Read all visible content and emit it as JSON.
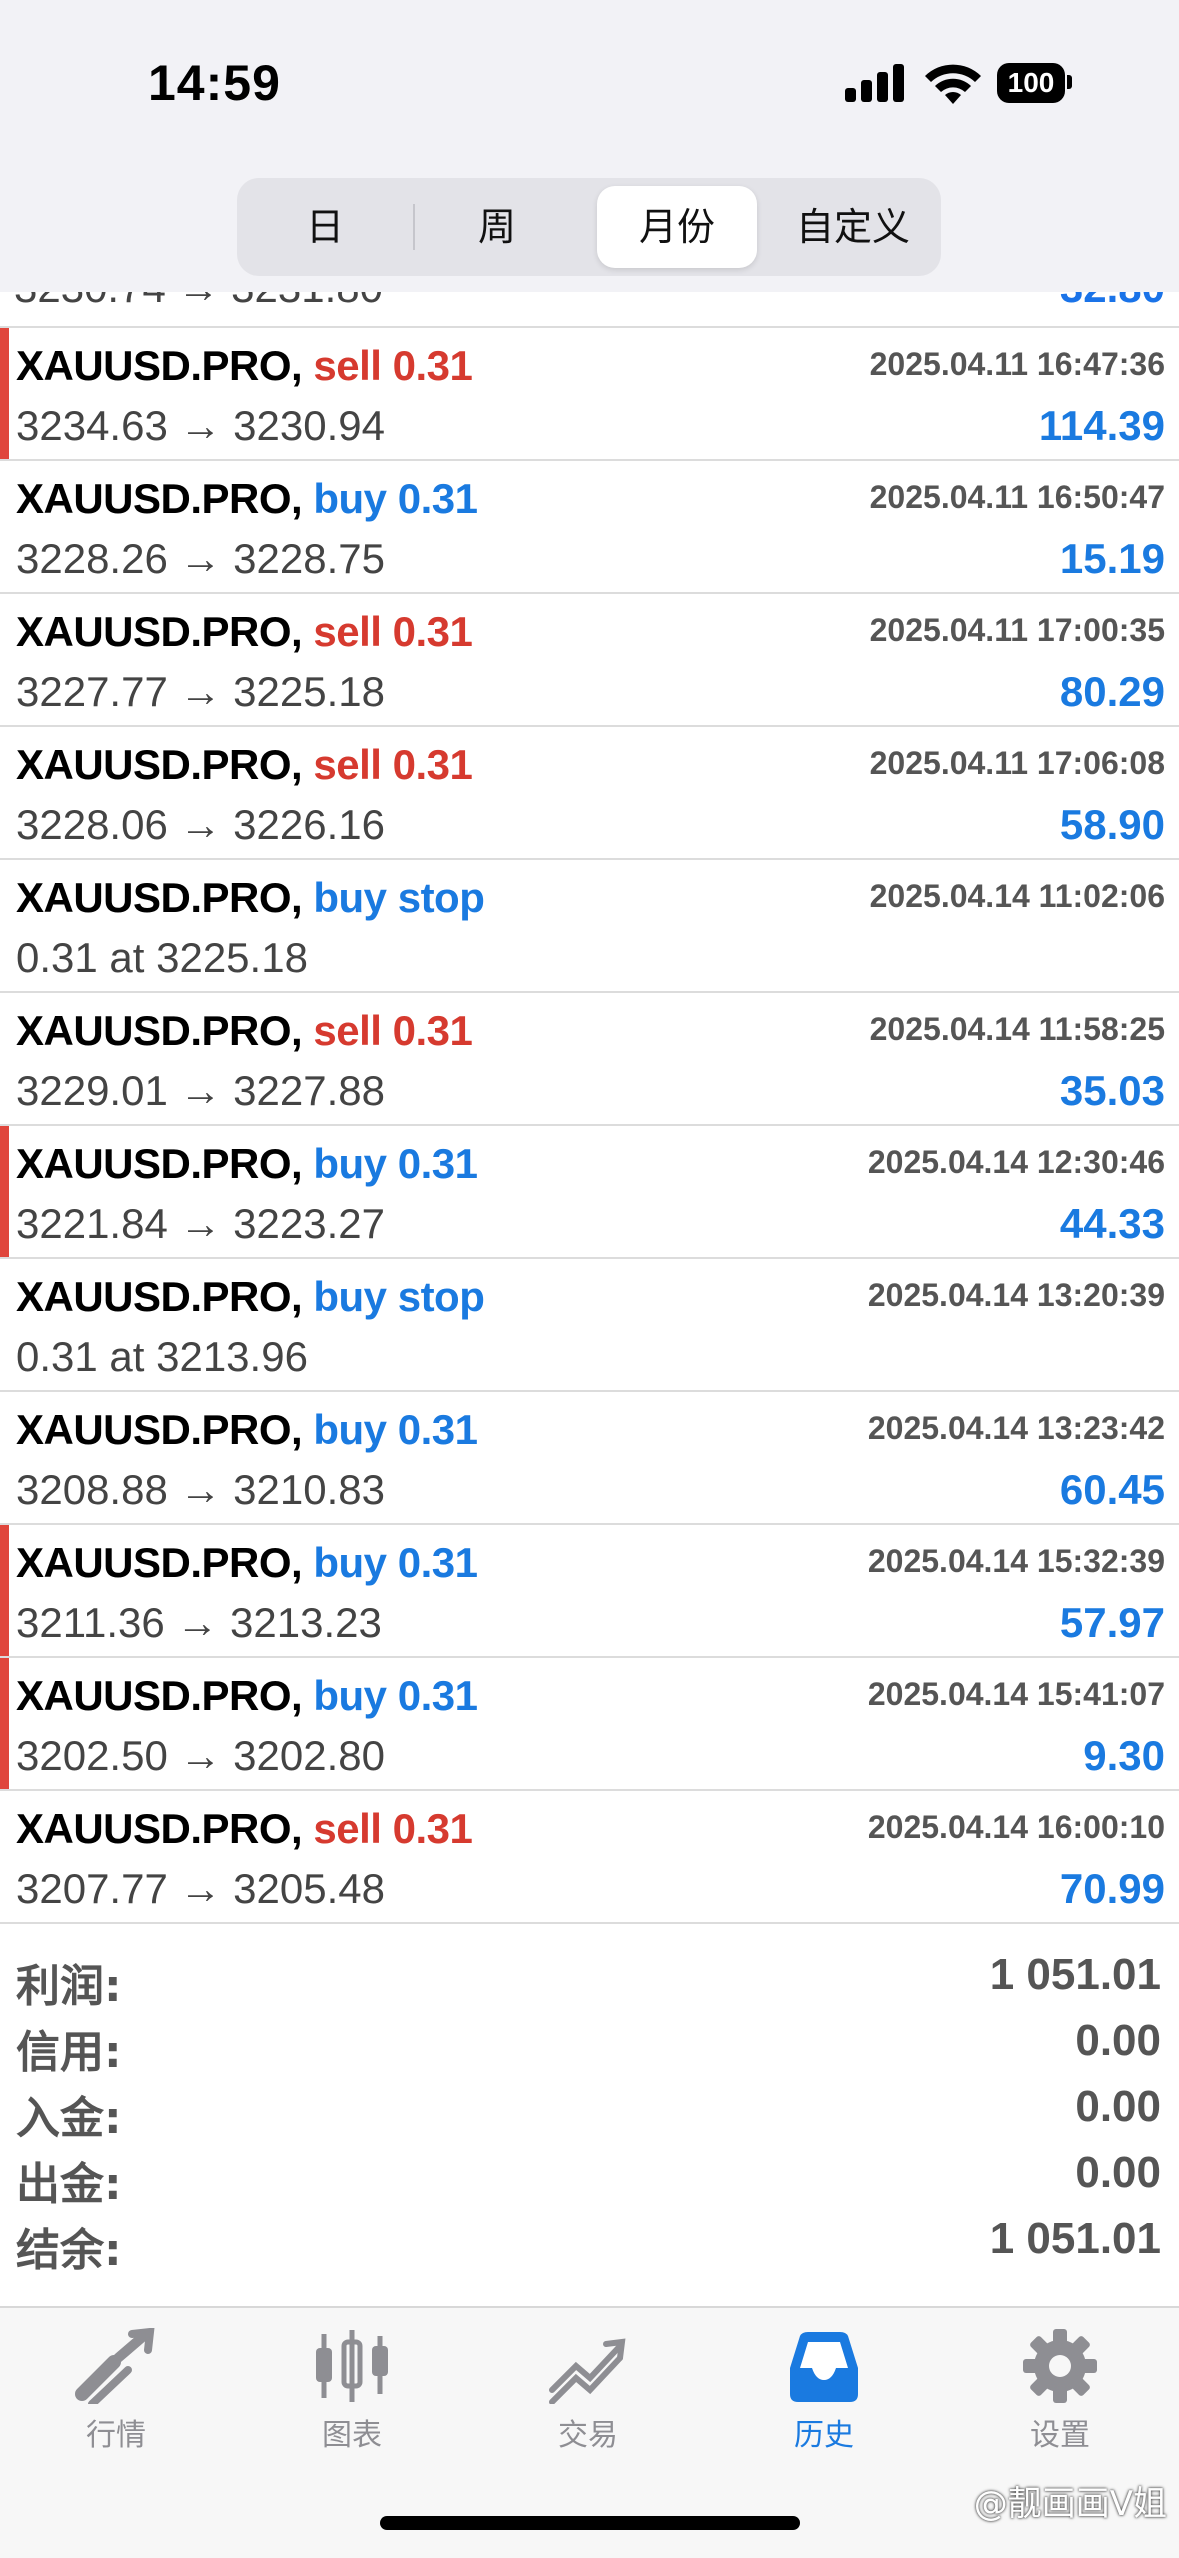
{
  "status": {
    "time": "14:59",
    "battery": "100"
  },
  "segments": [
    "日",
    "周",
    "月份",
    "自定义"
  ],
  "partial_row": {
    "left": "3230.74 → 3231.80",
    "right": "32.80"
  },
  "deals": [
    {
      "symbol": "XAUUSD.PRO,",
      "side": "sell 0.31",
      "type": "sell",
      "time": "2025.04.11 16:47:36",
      "prices": "3234.63 → 3230.94",
      "profit": "114.39",
      "marker": true
    },
    {
      "symbol": "XAUUSD.PRO,",
      "side": "buy 0.31",
      "type": "buy",
      "time": "2025.04.11 16:50:47",
      "prices": "3228.26 → 3228.75",
      "profit": "15.19",
      "marker": false
    },
    {
      "symbol": "XAUUSD.PRO,",
      "side": "sell 0.31",
      "type": "sell",
      "time": "2025.04.11 17:00:35",
      "prices": "3227.77 → 3225.18",
      "profit": "80.29",
      "marker": false
    },
    {
      "symbol": "XAUUSD.PRO,",
      "side": "sell 0.31",
      "type": "sell",
      "time": "2025.04.11 17:06:08",
      "prices": "3228.06 → 3226.16",
      "profit": "58.90",
      "marker": false
    },
    {
      "symbol": "XAUUSD.PRO,",
      "side": "buy stop",
      "type": "buy",
      "time": "2025.04.14 11:02:06",
      "prices": "0.31 at 3225.18",
      "profit": "",
      "marker": false
    },
    {
      "symbol": "XAUUSD.PRO,",
      "side": "sell 0.31",
      "type": "sell",
      "time": "2025.04.14 11:58:25",
      "prices": "3229.01 → 3227.88",
      "profit": "35.03",
      "marker": false
    },
    {
      "symbol": "XAUUSD.PRO,",
      "side": "buy 0.31",
      "type": "buy",
      "time": "2025.04.14 12:30:46",
      "prices": "3221.84 → 3223.27",
      "profit": "44.33",
      "marker": true
    },
    {
      "symbol": "XAUUSD.PRO,",
      "side": "buy stop",
      "type": "buy",
      "time": "2025.04.14 13:20:39",
      "prices": "0.31 at 3213.96",
      "profit": "",
      "marker": false
    },
    {
      "symbol": "XAUUSD.PRO,",
      "side": "buy 0.31",
      "type": "buy",
      "time": "2025.04.14 13:23:42",
      "prices": "3208.88 → 3210.83",
      "profit": "60.45",
      "marker": false
    },
    {
      "symbol": "XAUUSD.PRO,",
      "side": "buy 0.31",
      "type": "buy",
      "time": "2025.04.14 15:32:39",
      "prices": "3211.36 → 3213.23",
      "profit": "57.97",
      "marker": true
    },
    {
      "symbol": "XAUUSD.PRO,",
      "side": "buy 0.31",
      "type": "buy",
      "time": "2025.04.14 15:41:07",
      "prices": "3202.50 → 3202.80",
      "profit": "9.30",
      "marker": true
    },
    {
      "symbol": "XAUUSD.PRO,",
      "side": "sell 0.31",
      "type": "sell",
      "time": "2025.04.14 16:00:10",
      "prices": "3207.77 → 3205.48",
      "profit": "70.99",
      "marker": false
    }
  ],
  "summary": [
    {
      "label": "利润:",
      "value": "1 051.01"
    },
    {
      "label": "信用:",
      "value": "0.00"
    },
    {
      "label": "入金:",
      "value": "0.00"
    },
    {
      "label": "出金:",
      "value": "0.00"
    },
    {
      "label": "结余:",
      "value": "1 051.01"
    }
  ],
  "tabs": [
    {
      "label": "行情",
      "icon": "quotes-icon",
      "active": false
    },
    {
      "label": "图表",
      "icon": "chart-icon",
      "active": false
    },
    {
      "label": "交易",
      "icon": "trade-icon",
      "active": false
    },
    {
      "label": "历史",
      "icon": "history-icon",
      "active": true
    },
    {
      "label": "设置",
      "icon": "settings-icon",
      "active": false
    }
  ],
  "watermark": "@靓画画V姐",
  "colors": {
    "sell": "#d63a2f",
    "buy": "#1a7ae0",
    "marker": "#e0463c",
    "active_tab": "#1a7ae0"
  }
}
